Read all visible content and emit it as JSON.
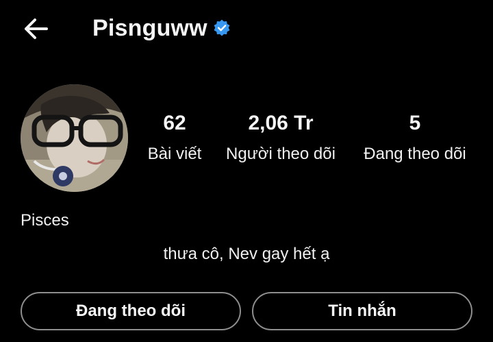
{
  "header": {
    "username": "Pisnguww",
    "verified": true,
    "back_icon": "arrow-left-icon",
    "verified_icon": "verified-badge-icon",
    "verified_color": "#3897f0"
  },
  "profile": {
    "avatar": "profile-photo",
    "stats": {
      "posts": {
        "value": "62",
        "label": "Bài viết"
      },
      "followers": {
        "value": "2,06 Tr",
        "label": "Người theo dõi"
      },
      "following": {
        "value": "5",
        "label": "Đang theo dõi"
      }
    },
    "name": "Pisces",
    "bio": "thưa cô, Nev gay hết ạ"
  },
  "actions": {
    "following_label": "Đang theo dõi",
    "message_label": "Tin nhắn"
  },
  "colors": {
    "background": "#000000",
    "text": "#f5f5f5",
    "button_border": "#8e8e8e"
  }
}
